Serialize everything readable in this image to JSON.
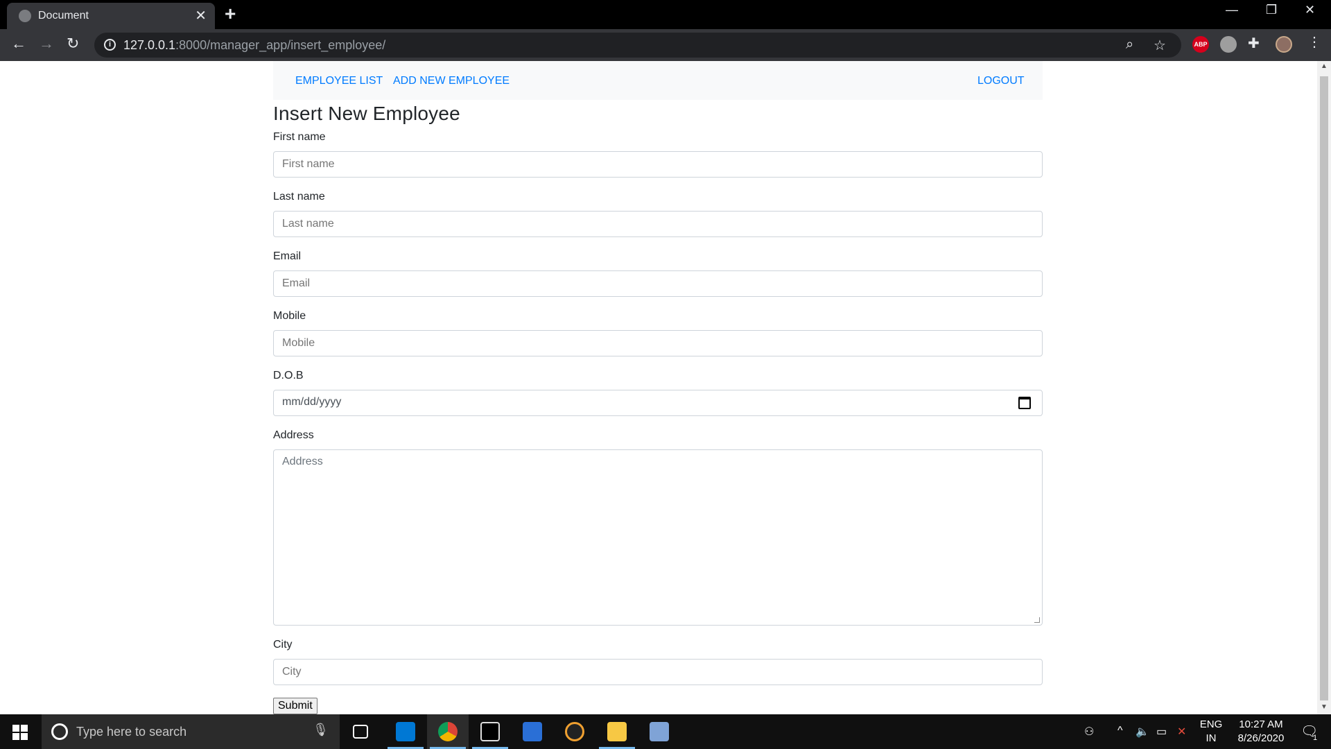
{
  "browser": {
    "tab_title": "Document",
    "url_host": "127.0.0.1",
    "url_path": ":8000/manager_app/insert_employee/",
    "extensions": {
      "abp_label": "ABP"
    }
  },
  "nav": {
    "employee_list": "EMPLOYEE LIST",
    "add_new_employee": "ADD NEW EMPLOYEE",
    "logout": "LOGOUT"
  },
  "form": {
    "title": "Insert New Employee",
    "first_name_label": "First name",
    "first_name_placeholder": "First name",
    "last_name_label": "Last name",
    "last_name_placeholder": "Last name",
    "email_label": "Email",
    "email_placeholder": "Email",
    "mobile_label": "Mobile",
    "mobile_placeholder": "Mobile",
    "dob_label": "D.O.B",
    "dob_placeholder": "mm/dd/yyyy",
    "address_label": "Address",
    "address_placeholder": "Address",
    "city_label": "City",
    "city_placeholder": "City",
    "submit_label": "Submit"
  },
  "taskbar": {
    "search_placeholder": "Type here to search",
    "lang_top": "ENG",
    "lang_bottom": "IN",
    "time": "10:27 AM",
    "date": "8/26/2020",
    "notification_count": "1"
  },
  "colors": {
    "link": "#007bff",
    "navbar_bg": "#f8f9fa",
    "chrome_dark": "#35363a",
    "taskbar_bg": "#101010"
  }
}
